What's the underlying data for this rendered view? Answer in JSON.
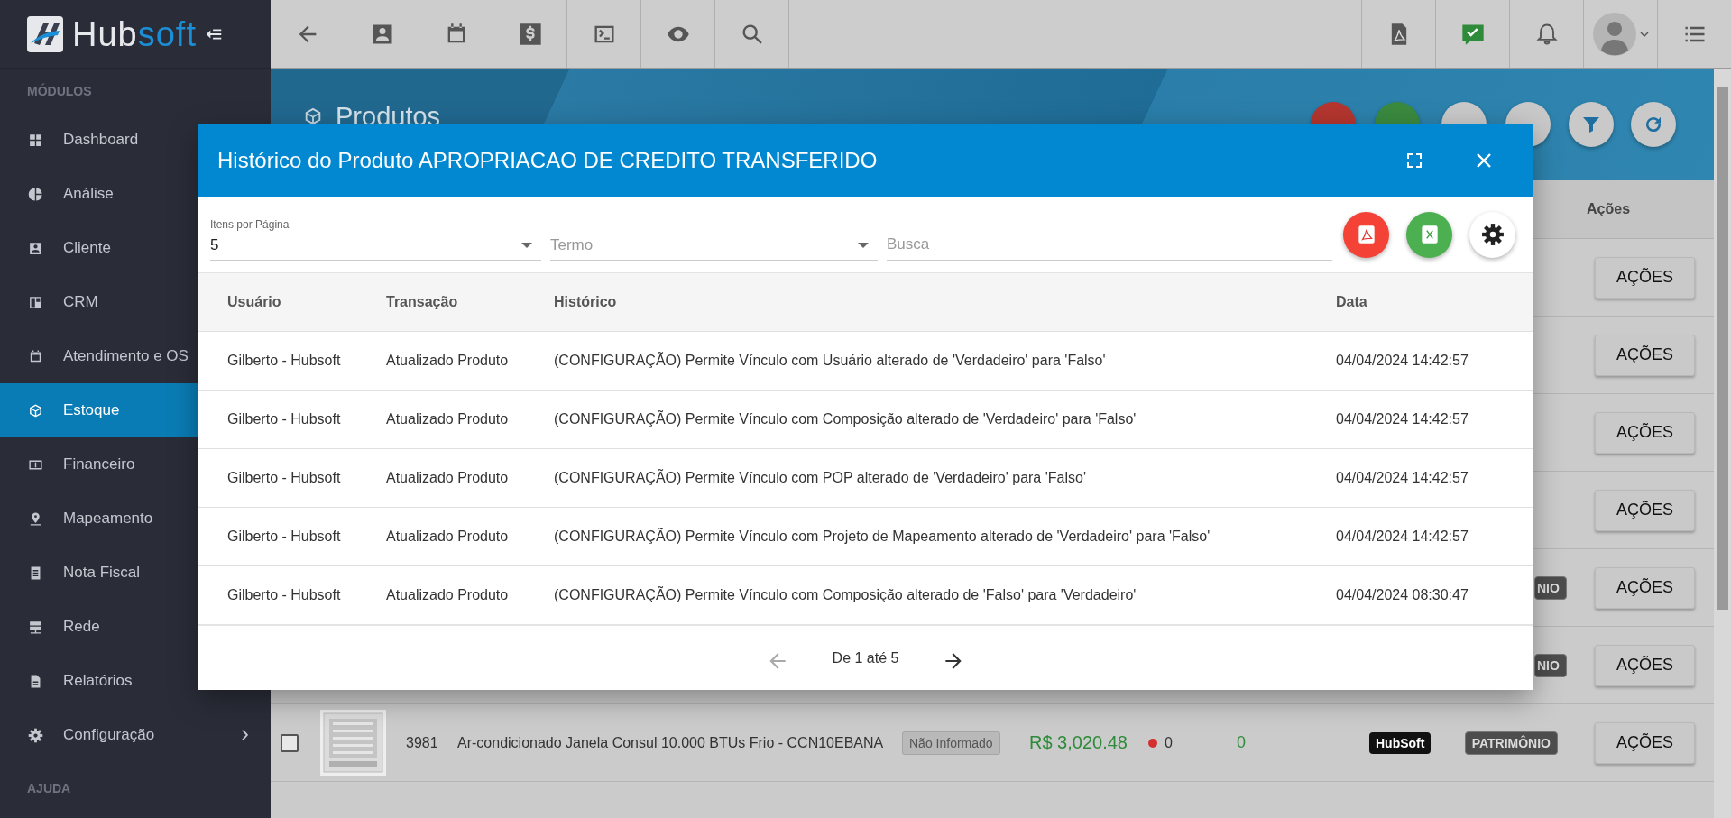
{
  "sidebar": {
    "logo": {
      "part_1": "Hub",
      "part_2": "soft"
    },
    "section": "MÓDULOS",
    "items": [
      {
        "label": "Dashboard",
        "selected": false
      },
      {
        "label": "Análise",
        "selected": false
      },
      {
        "label": "Cliente",
        "selected": false
      },
      {
        "label": "CRM",
        "selected": false
      },
      {
        "label": "Atendimento e OS",
        "selected": false
      },
      {
        "label": "Estoque",
        "selected": true
      },
      {
        "label": "Financeiro",
        "selected": false
      },
      {
        "label": "Mapeamento",
        "selected": false
      },
      {
        "label": "Nota Fiscal",
        "selected": false
      },
      {
        "label": "Rede",
        "selected": false
      },
      {
        "label": "Relatórios",
        "selected": false
      },
      {
        "label": "Configuração",
        "selected": false,
        "chevron": "›"
      }
    ],
    "help_section": "AJUDA"
  },
  "page": {
    "title": "Produtos",
    "table": {
      "header": "Ações",
      "rows": [
        {
          "action": "AÇÕES"
        },
        {
          "action": "AÇÕES"
        },
        {
          "action": "AÇÕES"
        },
        {
          "action": "AÇÕES"
        },
        {
          "tag_2": "NIO",
          "action": "AÇÕES"
        },
        {
          "tag_2": "NIO",
          "action": "AÇÕES"
        },
        {
          "checked": false,
          "code": "3981",
          "description": "Ar-condicionado Janela Consul 10.000 BTUs Frio - CCN10EBANA",
          "status": "Não Informado",
          "price": "R$ 3,020.48",
          "stock": "0",
          "column_7": "0",
          "brand": "HubSoft",
          "tag_2": "PATRIMÔNIO",
          "action": "AÇÕES"
        }
      ]
    }
  },
  "modal": {
    "title": "Histórico do Produto APROPRIACAO DE CREDITO TRANSFERIDO",
    "items_per_page": {
      "label": "Itens por Página",
      "value": "5"
    },
    "term": {
      "placeholder": "Termo"
    },
    "search": {
      "placeholder": "Busca"
    },
    "columns": [
      "Usuário",
      "Transação",
      "Histórico",
      "Data"
    ],
    "rows": [
      [
        "Gilberto - Hubsoft",
        "Atualizado Produto",
        "(CONFIGURAÇÃO) Permite Vínculo com Usuário alterado de 'Verdadeiro' para 'Falso'",
        "04/04/2024 14:42:57"
      ],
      [
        "Gilberto - Hubsoft",
        "Atualizado Produto",
        "(CONFIGURAÇÃO) Permite Vínculo com Composição alterado de 'Verdadeiro' para 'Falso'",
        "04/04/2024 14:42:57"
      ],
      [
        "Gilberto - Hubsoft",
        "Atualizado Produto",
        "(CONFIGURAÇÃO) Permite Vínculo com POP alterado de 'Verdadeiro' para 'Falso'",
        "04/04/2024 14:42:57"
      ],
      [
        "Gilberto - Hubsoft",
        "Atualizado Produto",
        "(CONFIGURAÇÃO) Permite Vínculo com Projeto de Mapeamento alterado de 'Verdadeiro' para 'Falso'",
        "04/04/2024 14:42:57"
      ],
      [
        "Gilberto - Hubsoft",
        "Atualizado Produto",
        "(CONFIGURAÇÃO) Permite Vínculo com Composição alterado de 'Falso' para 'Verdadeiro'",
        "04/04/2024 08:30:47"
      ]
    ],
    "pagination": {
      "text": "De 1 até 5",
      "prev_disabled": true,
      "next_disabled": false
    }
  }
}
